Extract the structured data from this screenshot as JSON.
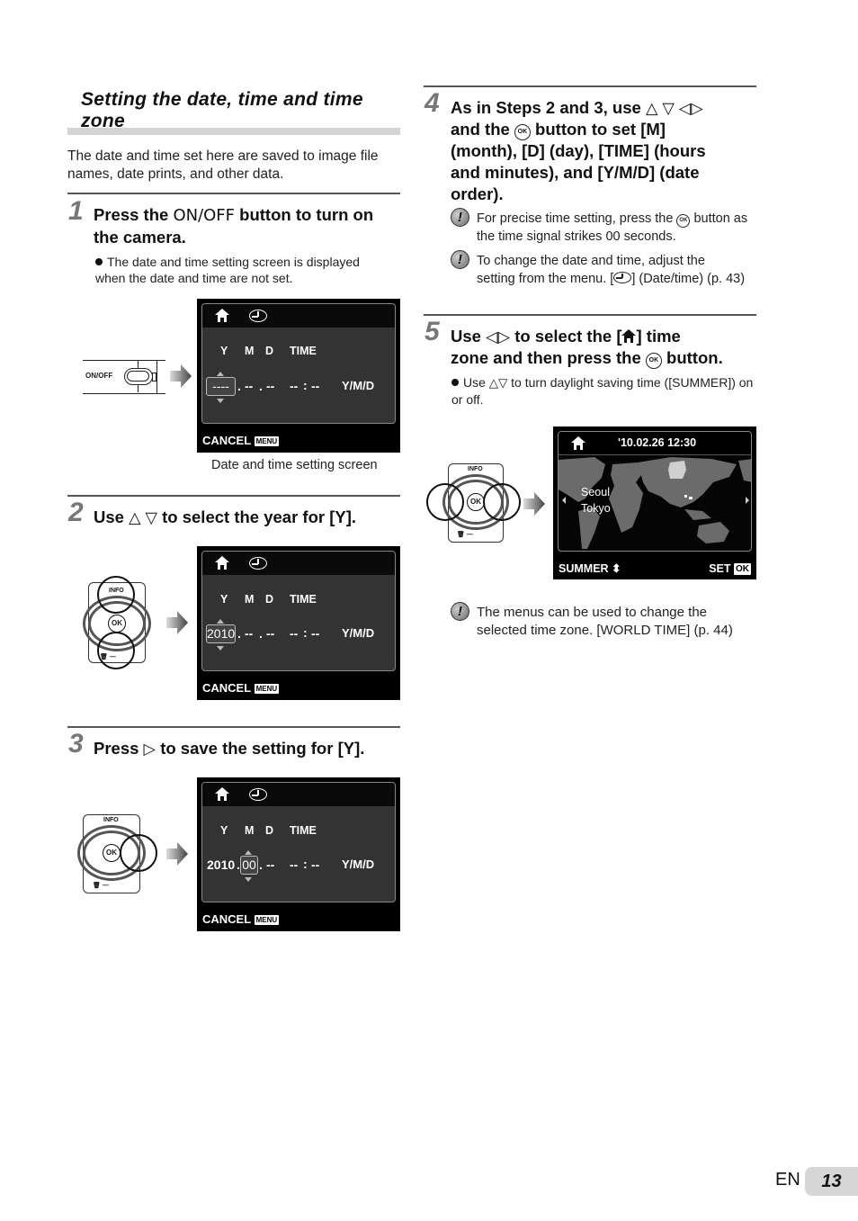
{
  "section": {
    "title": "Setting the date, time and time zone",
    "intro": "The date and time set here are saved to image file names, date prints, and other data."
  },
  "steps": [
    {
      "number": "1",
      "title_pre": "Press the ",
      "title_key": "ON/OFF",
      "title_post": " button to turn on the camera.",
      "bullet": "The date and time setting screen is displayed when the date and time are not set.",
      "illustration_label": "ON/OFF",
      "caption": "Date and time setting screen"
    },
    {
      "number": "2",
      "title_pre": "Use ",
      "title_symbols": "△ ▽",
      "title_post": " to select the year for [Y]."
    },
    {
      "number": "3",
      "title_pre": "Press ",
      "title_symbols": "▷",
      "title_post": " to save the setting for [Y]."
    },
    {
      "number": "4",
      "line1_pre": "As in Steps 2 and 3, use ",
      "line1_symbols": "△ ▽ ◁▷",
      "line2_pre": "and the ",
      "line2_post": " button to set [M]",
      "line3": "(month), [D] (day), [TIME] (hours",
      "line4": "and minutes), and [Y/M/D] (date",
      "line5": "order).",
      "notes": [
        {
          "pre": "For precise time setting, press the ",
          "post": " button as the time signal strikes 00 seconds."
        },
        {
          "pre": "To change the date and time, adjust the setting from the menu. [",
          "post": "] (Date/time) (p. 43)"
        }
      ]
    },
    {
      "number": "5",
      "line1_pre": "Use ",
      "line1_symbols": "◁▷",
      "line1_mid": " to select the [",
      "line1_post": "] time",
      "line2_pre": "zone and then press the ",
      "line2_post": " button.",
      "bullet_pre": "Use ",
      "bullet_symbols": "△▽",
      "bullet_post": " to turn daylight saving time ([SUMMER]) on or off.",
      "note": "The menus can be used to change the selected time zone. [WORLD TIME] (p. 44)"
    }
  ],
  "icons": {
    "ok_label": "OK",
    "note_glyph": "!"
  },
  "date_screens": [
    {
      "labels": {
        "y": "Y",
        "m": "M",
        "d": "D",
        "time": "TIME"
      },
      "year": "----",
      "sep1": ".",
      "month": "--",
      "sep2": ".",
      "day": "--",
      "hour": "--",
      "colon": ":",
      "minute": "--",
      "order": "Y/M/D",
      "cancel": "CANCEL",
      "menu": "MENU"
    },
    {
      "labels": {
        "y": "Y",
        "m": "M",
        "d": "D",
        "time": "TIME"
      },
      "year": "2010",
      "sep1": ".",
      "month": "--",
      "sep2": ".",
      "day": "--",
      "hour": "--",
      "colon": ":",
      "minute": "--",
      "order": "Y/M/D",
      "cancel": "CANCEL",
      "menu": "MENU"
    },
    {
      "labels": {
        "y": "Y",
        "m": "M",
        "d": "D",
        "time": "TIME"
      },
      "year": "2010",
      "sep1": ".",
      "month": "00",
      "sep2": ".",
      "day": "--",
      "hour": "--",
      "colon": ":",
      "minute": "--",
      "order": "Y/M/D",
      "cancel": "CANCEL",
      "menu": "MENU"
    }
  ],
  "world_screen": {
    "datetime": "'10.02.26 12:30",
    "city1": "Seoul",
    "city2": "Tokyo",
    "summer": "SUMMER",
    "summer_symbol": "⬍",
    "set": "SET",
    "ok": "OK"
  },
  "dial": {
    "info": "INFO",
    "ok": "OK"
  },
  "page": {
    "lang": "EN",
    "number": "13"
  }
}
